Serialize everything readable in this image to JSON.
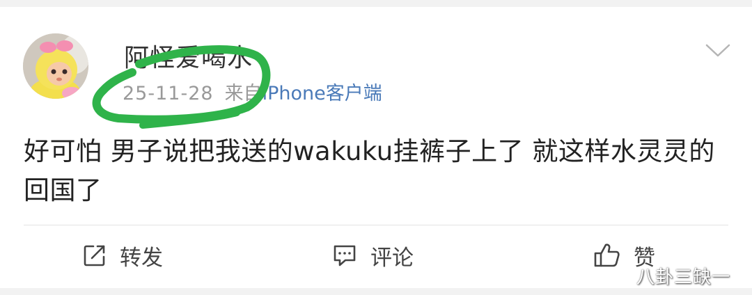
{
  "post": {
    "username": "阿怪爱喝水",
    "time": "25-11-28",
    "from_label": "来自",
    "source": "iPhone客户端",
    "text": "好可怕 男子说把我送的wakuku挂裤子上了 就这样水灵灵的回国了"
  },
  "actions": {
    "repost_label": "转发",
    "comment_label": "评论",
    "like_label": "赞"
  },
  "watermark": "八卦三缺一",
  "icons": {
    "menu": "chevron-down-icon",
    "repost": "share-square-icon",
    "comment": "comment-bubble-icon",
    "like": "thumbs-up-icon"
  },
  "colors": {
    "username": "#333333",
    "meta": "#999999",
    "source_link": "#4a7ab8",
    "highlight_marker": "#2fb34a",
    "action_text": "#444444"
  }
}
